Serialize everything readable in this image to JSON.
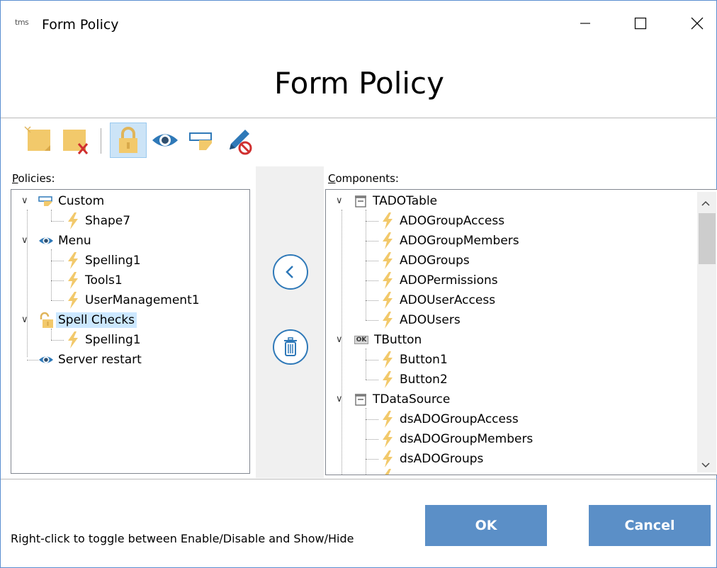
{
  "window": {
    "app_icon_text": "tms",
    "title": "Form Policy",
    "minimize_label": "Minimize",
    "maximize_label": "Maximize",
    "close_label": "Close"
  },
  "header": {
    "title": "Form Policy"
  },
  "toolbar": {
    "buttons": [
      {
        "name": "new-policy",
        "icon": "new-policy-icon"
      },
      {
        "name": "delete-policy",
        "icon": "delete-policy-icon"
      },
      {
        "name": "lock-policy",
        "icon": "lock-icon",
        "active": true
      },
      {
        "name": "visibility-policy",
        "icon": "eye-icon"
      },
      {
        "name": "custom-policy",
        "icon": "custom-shape-icon"
      },
      {
        "name": "no-edit-policy",
        "icon": "pencil-forbidden-icon"
      }
    ]
  },
  "policies": {
    "label_underlined": "P",
    "label_rest": "olicies:",
    "nodes": [
      {
        "label": "Custom",
        "icon": "custom-shape-icon",
        "level": 0,
        "expanded": true
      },
      {
        "label": "Shape7",
        "icon": "lightning-icon",
        "level": 1
      },
      {
        "label": "Menu",
        "icon": "eye-icon",
        "level": 0,
        "expanded": true
      },
      {
        "label": "Spelling1",
        "icon": "lightning-icon",
        "level": 1
      },
      {
        "label": "Tools1",
        "icon": "lightning-icon",
        "level": 1
      },
      {
        "label": "UserManagement1",
        "icon": "lightning-icon",
        "level": 1
      },
      {
        "label": "Spell Checks",
        "icon": "unlock-icon",
        "level": 0,
        "expanded": true,
        "selected": true
      },
      {
        "label": "Spelling1",
        "icon": "lightning-icon",
        "level": 1
      },
      {
        "label": "Server restart",
        "icon": "eye-icon",
        "level": 0
      }
    ]
  },
  "middle": {
    "move_left_label": "Move to policy",
    "delete_label": "Delete"
  },
  "components": {
    "label_underlined": "C",
    "label_rest": "omponents:",
    "nodes": [
      {
        "label": "TADOTable",
        "icon": "table-icon",
        "level": 0,
        "expanded": true
      },
      {
        "label": "ADOGroupAccess",
        "icon": "lightning-icon",
        "level": 1
      },
      {
        "label": "ADOGroupMembers",
        "icon": "lightning-icon",
        "level": 1
      },
      {
        "label": "ADOGroups",
        "icon": "lightning-icon",
        "level": 1
      },
      {
        "label": "ADOPermissions",
        "icon": "lightning-icon",
        "level": 1
      },
      {
        "label": "ADOUserAccess",
        "icon": "lightning-icon",
        "level": 1
      },
      {
        "label": "ADOUsers",
        "icon": "lightning-icon",
        "level": 1
      },
      {
        "label": "TButton",
        "icon": "ok-button-icon",
        "badge": "OK",
        "level": 0,
        "expanded": true
      },
      {
        "label": "Button1",
        "icon": "lightning-icon",
        "level": 1
      },
      {
        "label": "Button2",
        "icon": "lightning-icon",
        "level": 1
      },
      {
        "label": "TDataSource",
        "icon": "table-icon",
        "level": 0,
        "expanded": true
      },
      {
        "label": "dsADOGroupAccess",
        "icon": "lightning-icon",
        "level": 1
      },
      {
        "label": "dsADOGroupMembers",
        "icon": "lightning-icon",
        "level": 1
      },
      {
        "label": "dsADOGroups",
        "icon": "lightning-icon",
        "level": 1
      }
    ]
  },
  "footer": {
    "hint": "Right-click to toggle between Enable/Disable and Show/Hide",
    "ok_label": "OK",
    "cancel_label": "Cancel"
  },
  "colors": {
    "accent": "#5b8fc7",
    "selection": "#cce8ff",
    "icon_yellow": "#f2c96b",
    "icon_blue": "#2f79b8"
  }
}
